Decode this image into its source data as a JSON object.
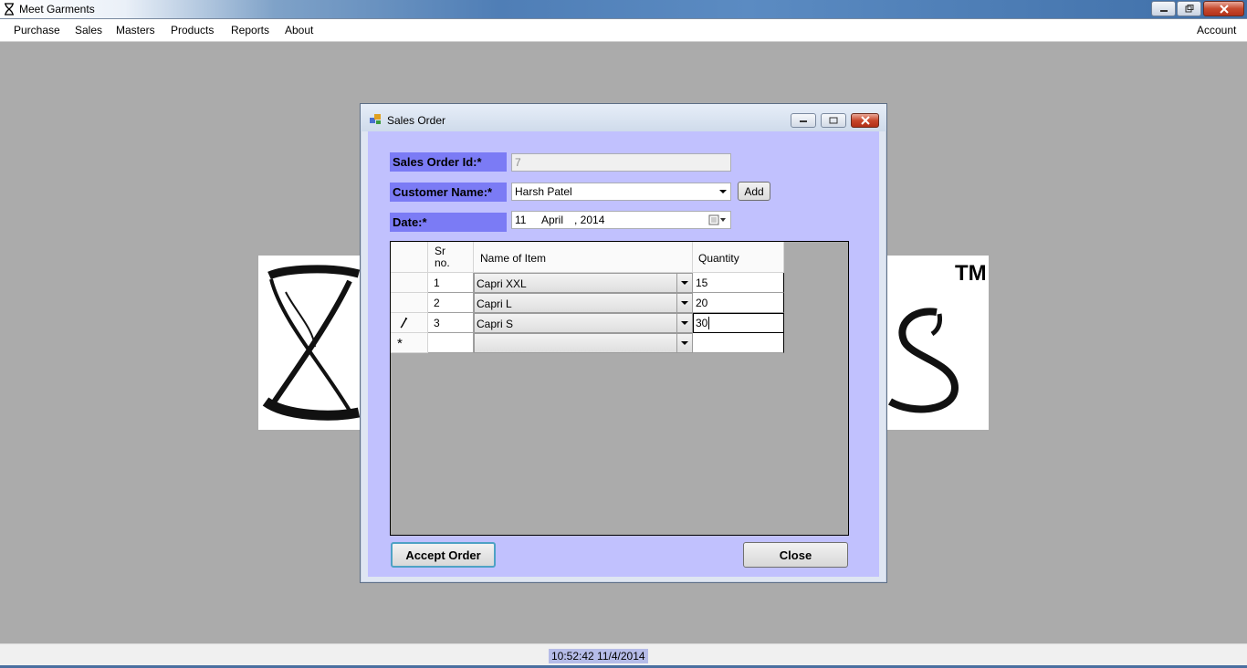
{
  "app": {
    "title": "Meet Garments"
  },
  "menu": {
    "items": [
      "Purchase",
      "Sales",
      "Masters",
      "Products",
      "Reports",
      "About"
    ],
    "right_item": "Account"
  },
  "logo": {
    "tm": "TM"
  },
  "status": {
    "clock": "10:52:42 11/4/2014"
  },
  "dialog": {
    "title": "Sales Order",
    "fields": {
      "order_id_label": "Sales Order Id:*",
      "order_id_value": "7",
      "customer_label": "Customer Name:*",
      "customer_value": "Harsh Patel",
      "add_label": "Add",
      "date_label": "Date:*",
      "date_day": "11",
      "date_month": "April",
      "date_year": ", 2014"
    },
    "grid": {
      "headers": {
        "sr": "Sr\nno.",
        "item": "Name of Item",
        "qty": "Quantity"
      },
      "rows": [
        {
          "sr": "1",
          "item": "Capri XXL",
          "qty": "15"
        },
        {
          "sr": "2",
          "item": "Capri L",
          "qty": "20"
        },
        {
          "sr": "3",
          "item": "Capri S",
          "qty": "30"
        }
      ],
      "new_row_marker": "*"
    },
    "buttons": {
      "accept": "Accept Order",
      "close": "Close"
    }
  },
  "colors": {
    "dialog_client": "#c1c1fe",
    "field_label_bg": "#7b7bf5",
    "desktop_bg": "#ababab",
    "status_highlight": "#b6bce8"
  }
}
